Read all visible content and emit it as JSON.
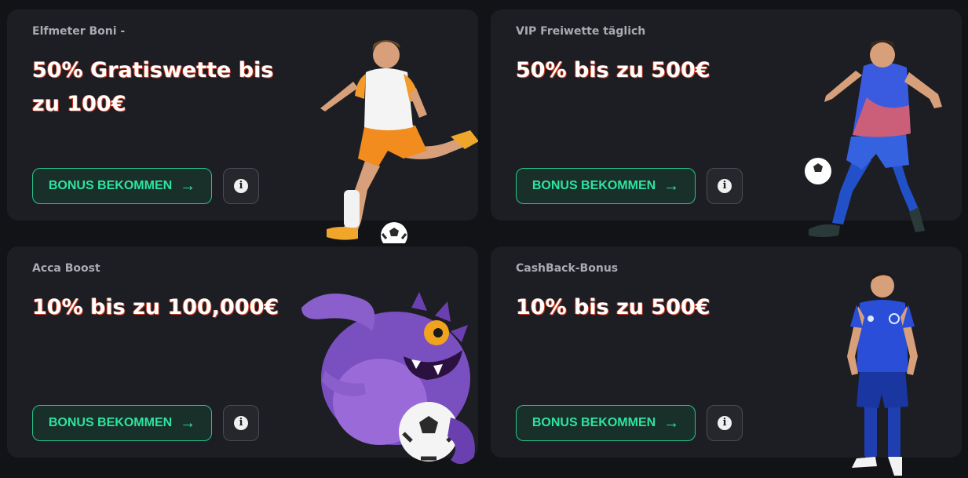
{
  "cards": [
    {
      "subtitle": "Elfmeter Boni -",
      "headline": "50% Gratiswette bis zu 100€",
      "button_label": "BONUS BEKOMMEN",
      "art": "footballer-kicking-white-orange-kit"
    },
    {
      "subtitle": "VIP Freiwette täglich",
      "headline": "50% bis zu 500€",
      "button_label": "BONUS BEKOMMEN",
      "art": "footballer-blue-kit-with-ball"
    },
    {
      "subtitle": "Acca Boost",
      "headline": "10% bis zu 100,000€",
      "button_label": "BONUS BEKOMMEN",
      "art": "purple-monster-holding-ball"
    },
    {
      "subtitle": "CashBack-Bonus",
      "headline": "10% bis zu 500€",
      "button_label": "BONUS BEKOMMEN",
      "art": "footballer-standing-blue-kit"
    }
  ],
  "icons": {
    "arrow": "arrow-right-icon",
    "info": "info-icon"
  },
  "colors": {
    "background": "#121316",
    "card": "#1d1e23",
    "accent": "#2ee3a0",
    "subtitle": "#a9abb2"
  }
}
